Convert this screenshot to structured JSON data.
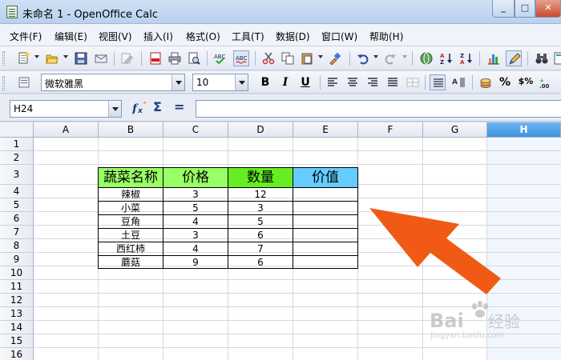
{
  "window": {
    "title": "未命名 1 - OpenOffice Calc"
  },
  "menu": [
    "文件(F)",
    "编辑(E)",
    "视图(V)",
    "插入(I)",
    "格式(O)",
    "工具(T)",
    "数据(D)",
    "窗口(W)",
    "帮助(H)"
  ],
  "format_toolbar": {
    "font_name": "微软雅黑",
    "font_size": "10",
    "bold": "B",
    "italic": "I",
    "underline": "U",
    "currency": "$",
    "percent": "%",
    "currency_format": "$%"
  },
  "formula_bar": {
    "cell_ref": "H24",
    "input_value": "",
    "sum_symbol": "Σ",
    "equals_symbol": "="
  },
  "sheet": {
    "columns": [
      "A",
      "B",
      "C",
      "D",
      "E",
      "F",
      "G",
      "H"
    ],
    "selected_column": "H",
    "rows": [
      "1",
      "2",
      "3",
      "4",
      "5",
      "6",
      "7",
      "8",
      "9",
      "10",
      "11",
      "12",
      "13",
      "14",
      "15",
      "16"
    ],
    "table_headers": [
      "蔬菜名称",
      "价格",
      "数量",
      "价值"
    ],
    "header_colors": [
      "#99ff66",
      "#99ff66",
      "#66ee22",
      "#66ccff"
    ],
    "table_rows": [
      [
        "辣椒",
        "3",
        "12",
        ""
      ],
      [
        "小菜",
        "5",
        "3",
        ""
      ],
      [
        "豆角",
        "4",
        "5",
        ""
      ],
      [
        "土豆",
        "3",
        "6",
        ""
      ],
      [
        "西红柿",
        "4",
        "7",
        ""
      ],
      [
        "蘑菇",
        "9",
        "6",
        ""
      ]
    ]
  },
  "overlay": {
    "arrow_color": "#f05a14"
  },
  "watermark": {
    "logo": "Bai",
    "brand": "经验",
    "url": "jingyan.baidu.com"
  }
}
